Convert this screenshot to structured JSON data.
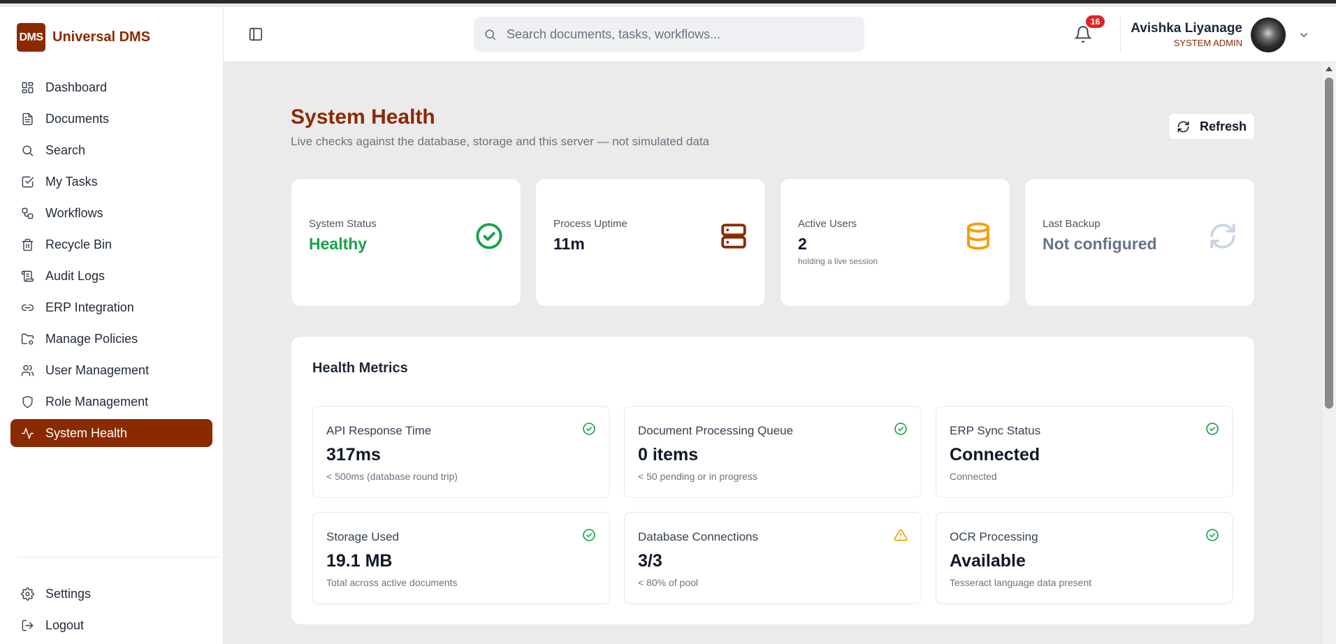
{
  "brand": {
    "logo_text": "DMS",
    "name": "Universal DMS"
  },
  "sidebar": {
    "items": [
      {
        "label": "Dashboard",
        "icon": "dashboard-icon"
      },
      {
        "label": "Documents",
        "icon": "file-text-icon"
      },
      {
        "label": "Search",
        "icon": "search-icon"
      },
      {
        "label": "My Tasks",
        "icon": "check-square-icon"
      },
      {
        "label": "Workflows",
        "icon": "workflow-icon"
      },
      {
        "label": "Recycle Bin",
        "icon": "trash-icon"
      },
      {
        "label": "Audit Logs",
        "icon": "scroll-icon"
      },
      {
        "label": "ERP Integration",
        "icon": "link-icon"
      },
      {
        "label": "Manage Policies",
        "icon": "folder-cog-icon"
      },
      {
        "label": "User Management",
        "icon": "users-icon"
      },
      {
        "label": "Role Management",
        "icon": "shield-icon"
      },
      {
        "label": "System Health",
        "icon": "activity-icon",
        "active": true
      }
    ],
    "bottom": [
      {
        "label": "Settings",
        "icon": "gear-icon"
      },
      {
        "label": "Logout",
        "icon": "logout-icon"
      }
    ]
  },
  "header": {
    "search_placeholder": "Search documents, tasks, workflows...",
    "notification_count": "16",
    "user_name": "Avishka Liyanage",
    "user_role": "SYSTEM ADMIN"
  },
  "page": {
    "title": "System Health",
    "subtitle": "Live checks against the database, storage and this server — not simulated data",
    "refresh_label": "Refresh"
  },
  "stats": [
    {
      "label": "System Status",
      "value": "Healthy",
      "note": "",
      "icon": "check-circle-icon",
      "value_color": "#16a34a",
      "icon_color": "#16a34a"
    },
    {
      "label": "Process Uptime",
      "value": "11m",
      "note": "",
      "icon": "server-icon",
      "value_color": "#111827",
      "icon_color": "#8b2a00"
    },
    {
      "label": "Active Users",
      "value": "2",
      "note": "holding a live session",
      "icon": "database-icon",
      "value_color": "#111827",
      "icon_color": "#f59e0b"
    },
    {
      "label": "Last Backup",
      "value": "Not configured",
      "note": "",
      "icon": "refresh-icon",
      "value_color": "#64748b",
      "icon_color": "#cbd5e1"
    }
  ],
  "metrics": {
    "title": "Health Metrics",
    "items": [
      {
        "label": "API Response Time",
        "value": "317ms",
        "note": "< 500ms (database round trip)",
        "status": "ok"
      },
      {
        "label": "Document Processing Queue",
        "value": "0 items",
        "note": "< 50 pending or in progress",
        "status": "ok"
      },
      {
        "label": "ERP Sync Status",
        "value": "Connected",
        "note": "Connected",
        "status": "ok"
      },
      {
        "label": "Storage Used",
        "value": "19.1 MB",
        "note": "Total across active documents",
        "status": "ok"
      },
      {
        "label": "Database Connections",
        "value": "3/3",
        "note": "< 80% of pool",
        "status": "warning"
      },
      {
        "label": "OCR Processing",
        "value": "Available",
        "note": "Tesseract language data present",
        "status": "ok"
      }
    ]
  },
  "colors": {
    "brand": "#8b2a00",
    "ok": "#16a34a",
    "warning": "#f59e0b"
  }
}
